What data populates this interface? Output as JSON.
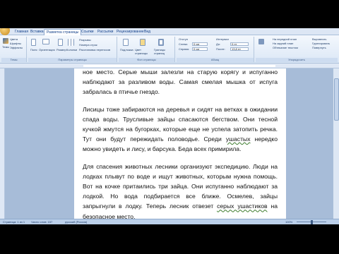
{
  "tabs": [
    "Главная",
    "Вставка",
    "Разметка страницы",
    "Ссылки",
    "Рассылки",
    "Рецензирование",
    "Вид"
  ],
  "active_tab_index": 2,
  "ribbon": {
    "groups": [
      "Темы",
      "Параметры страницы",
      "Фон страницы",
      "Абзац",
      "Упорядочить"
    ],
    "themes": {
      "btn": "Темы",
      "colors": "Цвета",
      "fonts": "Шрифты",
      "effects": "Эффекты"
    },
    "page_setup": {
      "margins": "Поля",
      "orientation": "Ориентация",
      "size": "Размер",
      "columns": "Колонки",
      "breaks": "Разрывы",
      "line_numbers": "Номера строк",
      "hyphenation": "Расстановка переносов"
    },
    "background": {
      "watermark": "Подложка",
      "color": "Цвет страницы",
      "borders": "Границы страниц"
    },
    "paragraph": {
      "indent": "Отступ",
      "left_label": "Слева:",
      "left_val": "0 см",
      "right_label": "Справа:",
      "right_val": "0 см",
      "spacing": "Интервал",
      "before_label": "До:",
      "before_val": "0 пт",
      "after_label": "После:",
      "after_val": "13,8 пт"
    },
    "arrange": {
      "front": "На передний план",
      "back": "На задний план",
      "wrap": "Обтекание текстом",
      "align": "Выровнять",
      "group": "Группировать",
      "rotate": "Повернуть"
    }
  },
  "document": {
    "paragraphs": [
      "ное место. Серые мыши залезли на старую корягу и испуганно наблюдают за разливом воды. Самая смелая мышка от испуга забралась в птичье гнездо.",
      "Лисицы тоже забираются на деревья и сидят на ветках в ожидании спада воды. Трусливые зайцы спасаются бегством. Они тесной кучкой жмутся на бугорках, которые еще не успела затопить речка. Тут они будут пережидать половодье. Среди",
      "Для спасения животных лесники организуют экспедицию. Люди на лодках плывут по воде и ищут животных, которым нужна помощь. Вот на кочке притаились три зайца. Они испуганно наблюдают за лодкой. Но вода подбирается все ближе. Осмелев, зайцы запрыгнули в лодку. Теперь лесник отвезет"
    ],
    "p2_underlined": "ушастых",
    "p2_tail_1": " нередко можно увидеть и лису, и барсука. Беда всех примирила.",
    "p3_underlined": "серых ушастиков",
    "p3_tail": " на безопасное место."
  },
  "status": {
    "page": "Страница: 1 из 1",
    "words": "Число слов: 157",
    "lang": "русский (Россия)",
    "zoom": "100%"
  },
  "colors": {
    "ribbon_bg": "#dbe7f6",
    "tab_text": "#15428b",
    "status_bg": "#bcd0ea"
  }
}
